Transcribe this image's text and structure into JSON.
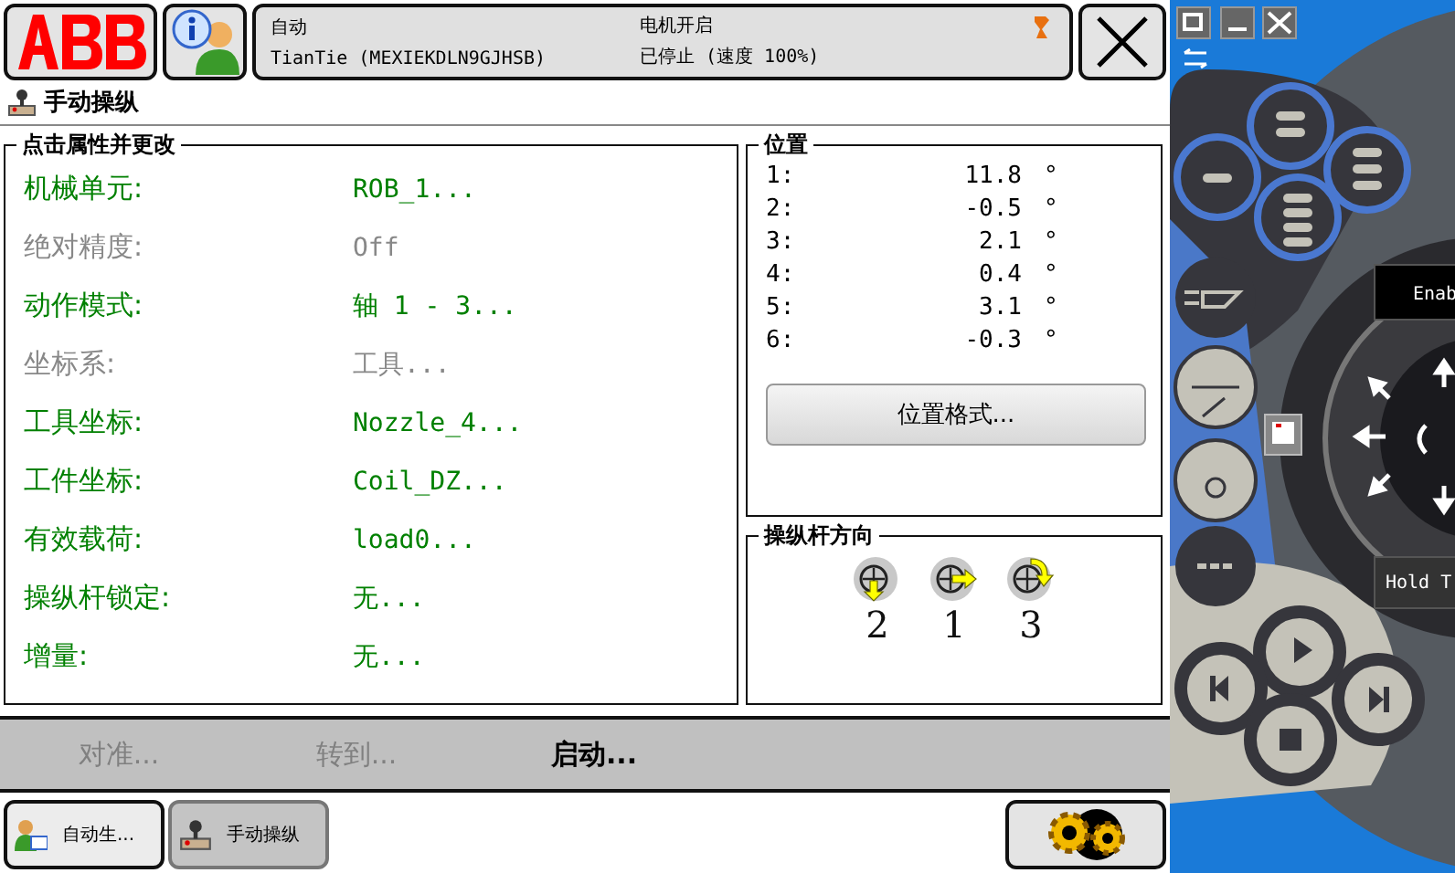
{
  "header": {
    "mode": "自动",
    "controller": "TianTie (MEXIEKDLN9GJHSB)",
    "motor": "电机开启",
    "state": "已停止 (速度 100%)"
  },
  "page_title": "手动操纵",
  "properties": {
    "title": "点击属性并更改",
    "items": [
      {
        "label": "机械单元:",
        "value": "ROB_1...",
        "disabled": false
      },
      {
        "label": "绝对精度:",
        "value": "Off",
        "disabled": true
      },
      {
        "label": "动作模式:",
        "value": "轴 1 - 3...",
        "disabled": false
      },
      {
        "label": "坐标系:",
        "value": "工具...",
        "disabled": true
      },
      {
        "label": "工具坐标:",
        "value": "Nozzle_4...",
        "disabled": false
      },
      {
        "label": "工件坐标:",
        "value": "Coil_DZ...",
        "disabled": false
      },
      {
        "label": "有效载荷:",
        "value": "load0...",
        "disabled": false
      },
      {
        "label": "操纵杆锁定:",
        "value": "无...",
        "disabled": false
      },
      {
        "label": "增量:",
        "value": "无...",
        "disabled": false
      }
    ]
  },
  "position": {
    "title": "位置",
    "rows": [
      {
        "axis": "1:",
        "value": "11.8",
        "unit": "°"
      },
      {
        "axis": "2:",
        "value": "-0.5",
        "unit": "°"
      },
      {
        "axis": "3:",
        "value": "2.1",
        "unit": "°"
      },
      {
        "axis": "4:",
        "value": "0.4",
        "unit": "°"
      },
      {
        "axis": "5:",
        "value": "3.1",
        "unit": "°"
      },
      {
        "axis": "6:",
        "value": "-0.3",
        "unit": "°"
      }
    ],
    "format_button": "位置格式..."
  },
  "joystick": {
    "title": "操纵杆方向",
    "axes": [
      {
        "kind": "down",
        "label": "2"
      },
      {
        "kind": "right",
        "label": "1"
      },
      {
        "kind": "rotate",
        "label": "3"
      }
    ]
  },
  "actions": [
    {
      "label": "对准...",
      "disabled": true
    },
    {
      "label": "转到...",
      "disabled": true
    },
    {
      "label": "启动...",
      "disabled": false
    }
  ],
  "taskbar": [
    {
      "kind": "auto",
      "label": "自动生...",
      "selected": false
    },
    {
      "kind": "jog",
      "label": "手动操纵",
      "selected": true
    }
  ],
  "pendant": {
    "enable_label": "Enab",
    "hold_label": "Hold T"
  }
}
